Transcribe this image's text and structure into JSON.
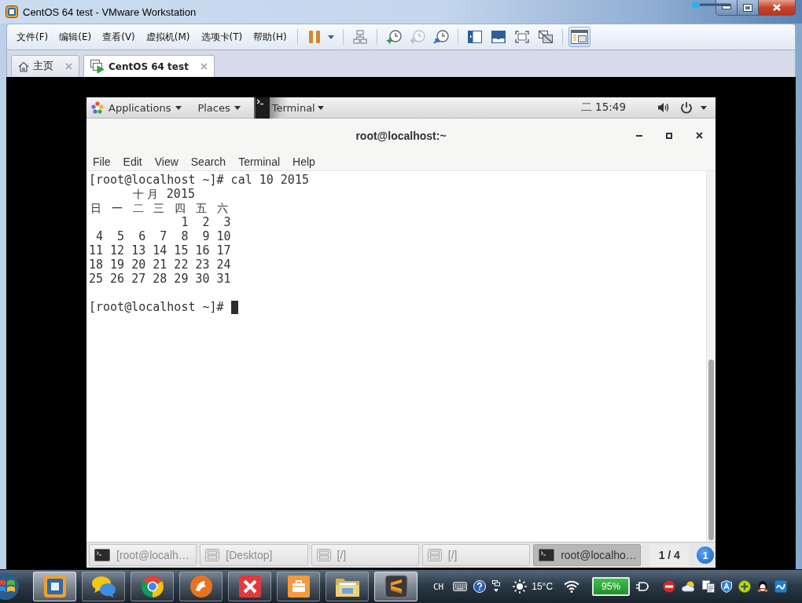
{
  "window": {
    "title": "CentOS 64 test - VMware Workstation"
  },
  "menu": [
    "文件(F)",
    "编辑(E)",
    "查看(V)",
    "虚拟机(M)",
    "选项卡(T)",
    "帮助(H)"
  ],
  "toolbar": [
    [
      {
        "kind": "pause"
      },
      {
        "kind": "caret"
      }
    ],
    [
      {
        "kind": "network"
      }
    ],
    [
      {
        "kind": "snapshot",
        "disabled": false
      },
      {
        "kind": "revert",
        "disabled": true
      },
      {
        "kind": "manager",
        "disabled": false
      }
    ],
    [
      {
        "kind": "sidebar",
        "selected": false
      },
      {
        "kind": "console",
        "selected": false
      },
      {
        "kind": "fullscreen",
        "selected": false
      },
      {
        "kind": "unity",
        "selected": false
      }
    ],
    [
      {
        "kind": "thumbnails",
        "selected": true
      }
    ]
  ],
  "tabs": [
    {
      "label": "主页",
      "kind": "home",
      "selected": false
    },
    {
      "label": "CentOS 64 test",
      "kind": "vm",
      "selected": true
    }
  ],
  "guest": {
    "top_bar": {
      "applications": "Applications",
      "places": "Places",
      "app_menu": "Terminal",
      "clock": "二 15:49"
    },
    "terminal": {
      "title": "root@localhost:~",
      "menu": [
        "File",
        "Edit",
        "View",
        "Search",
        "Terminal",
        "Help"
      ],
      "output": [
        "[root@localhost ~]# cal 10 2015",
        "      十月 2015",
        "日 一 二 三 四 五 六",
        "             1  2  3",
        " 4  5  6  7  8  9 10",
        "11 12 13 14 15 16 17",
        "18 19 20 21 22 23 24",
        "25 26 27 28 29 30 31"
      ],
      "prompt": "[root@localhost ~]#",
      "cursor": true
    },
    "window_list": [
      {
        "label": "[root@localh…",
        "kind": "terminal",
        "selected": false
      },
      {
        "label": "[Desktop]",
        "kind": "drawer",
        "selected": false
      },
      {
        "label": "[/]",
        "kind": "drawer",
        "selected": false
      },
      {
        "label": "[/]",
        "kind": "drawer",
        "selected": false
      },
      {
        "label": "root@localho…",
        "kind": "terminal",
        "selected": true
      }
    ],
    "workspace": "1 / 4",
    "notifications": "1"
  },
  "taskbar": {
    "apps": [
      {
        "kind": "vmware",
        "highlighted": true
      },
      {
        "kind": "messenger",
        "highlighted": false
      },
      {
        "kind": "chrome",
        "highlighted": false
      },
      {
        "kind": "browser",
        "highlighted": false
      },
      {
        "kind": "xmind",
        "highlighted": false
      },
      {
        "kind": "briefcase",
        "highlighted": false
      },
      {
        "kind": "explorer",
        "highlighted": false
      },
      {
        "kind": "sublime",
        "highlighted": true
      }
    ],
    "language": "CH",
    "temperature": "15°C",
    "battery": "95%"
  }
}
